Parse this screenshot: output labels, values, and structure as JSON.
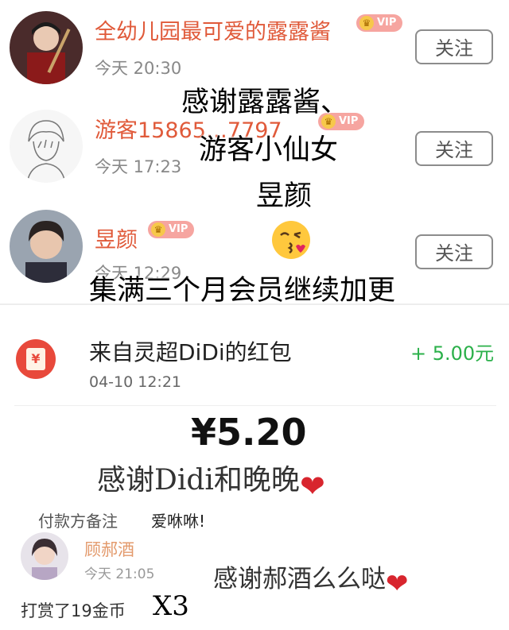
{
  "followers": [
    {
      "name": "全幼儿园最可爱的露露酱",
      "vip": "VIP",
      "time": "今天 20:30",
      "follow_label": "关注"
    },
    {
      "name": "游客15865…7797",
      "vip": "VIP",
      "time": "今天 17:23",
      "follow_label": "关注"
    },
    {
      "name": "昱颜",
      "vip": "VIP",
      "time": "今天 12:29",
      "follow_label": "关注"
    }
  ],
  "red_packet": {
    "title": "来自灵超DiDi的红包",
    "date": "04-10 12:21",
    "amount": "+ 5.00元",
    "icon": "¥"
  },
  "payment": {
    "amount": "¥5.20",
    "note_label": "付款方备注",
    "note_value": "爱咻咻!"
  },
  "gift": {
    "name": "顾郝酒",
    "time": "今天 21:05",
    "text": "打赏了19金币"
  },
  "captions": {
    "line1": "感谢露露酱、",
    "line2": "游客小仙女",
    "line3": "昱颜",
    "line4": "集满三个月会员继续加更",
    "line5": "感谢Didi和晚晚",
    "line6": "感谢郝酒么么哒",
    "times": "X3"
  },
  "colors": {
    "username": "#e05a3a",
    "vip_badge": "#f6a5a0",
    "amount_green": "#2bb04a",
    "red_packet": "#e8493b",
    "heart": "#d8252e"
  }
}
